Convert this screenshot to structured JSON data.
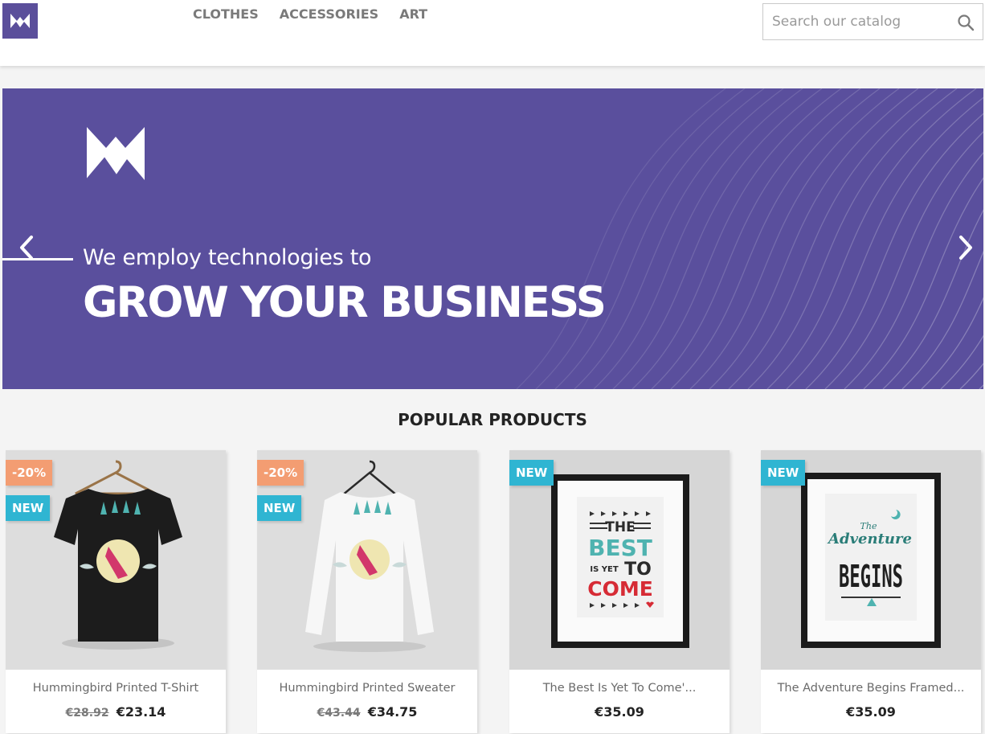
{
  "header": {
    "nav": [
      "CLOTHES",
      "ACCESSORIES",
      "ART"
    ],
    "search_placeholder": "Search our catalog"
  },
  "banner": {
    "subtitle": "We employ technologies to",
    "title": "GROW YOUR BUSINESS"
  },
  "section_title": "POPULAR PRODUCTS",
  "products": [
    {
      "name": "Hummingbird Printed T-Shirt",
      "old_price": "€28.92",
      "price": "€23.14",
      "discount": "-20%",
      "flag": "NEW"
    },
    {
      "name": "Hummingbird Printed Sweater",
      "old_price": "€43.44",
      "price": "€34.75",
      "discount": "-20%",
      "flag": "NEW"
    },
    {
      "name": "The Best Is Yet To Come'...",
      "price": "€35.09",
      "flag": "NEW",
      "poster_text": [
        "THE",
        "BEST",
        "IS YET",
        "TO",
        "COME"
      ]
    },
    {
      "name": "The Adventure Begins Framed...",
      "price": "€35.09",
      "flag": "NEW",
      "poster_text": [
        "The",
        "Adventure",
        "BEGINS"
      ]
    }
  ],
  "colors": {
    "brand": "#5b4f9b",
    "badge_new": "#2fb5d2",
    "badge_discount": "#f39d72"
  },
  "icons": [
    "logo-icon",
    "search-icon",
    "chevron-left-icon",
    "chevron-right-icon"
  ]
}
